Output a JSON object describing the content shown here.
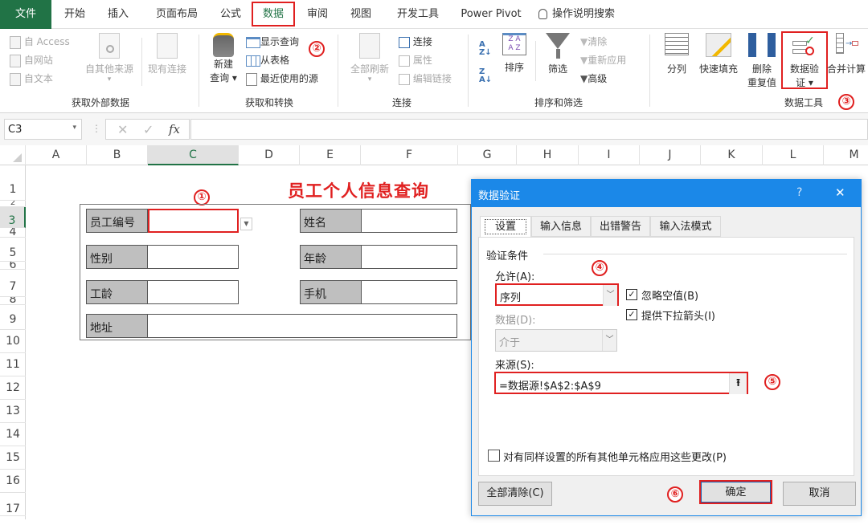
{
  "menu_tabs": [
    {
      "label": "文件"
    },
    {
      "label": "开始"
    },
    {
      "label": "插入"
    },
    {
      "label": "页面布局"
    },
    {
      "label": "公式"
    },
    {
      "label": "数据"
    },
    {
      "label": "审阅"
    },
    {
      "label": "视图"
    },
    {
      "label": "开发工具"
    },
    {
      "label": "Power Pivot"
    },
    {
      "label": "操作说明搜索"
    }
  ],
  "ribbon": {
    "get_external": {
      "label": "获取外部数据",
      "from_access": "自 Access",
      "from_web": "自网站",
      "from_text": "自文本",
      "from_other": "自其他来源",
      "existing": "现有连接"
    },
    "get_transform": {
      "label": "获取和转换",
      "new_query_1": "新建",
      "new_query_2": "查询",
      "show_queries": "显示查询",
      "from_table": "从表格",
      "recent_sources": "最近使用的源"
    },
    "connections": {
      "label": "连接",
      "refresh_all": "全部刷新",
      "connections": "连接",
      "properties": "属性",
      "edit_links": "编辑链接"
    },
    "sort_filter": {
      "label": "排序和筛选",
      "sort": "排序",
      "filter": "筛选",
      "clear": "清除",
      "reapply": "重新应用",
      "advanced": "高级"
    },
    "data_tools": {
      "label": "数据工具",
      "text_to_columns": "分列",
      "flash_fill": "快速填充",
      "remove_dup_1": "删除",
      "remove_dup_2": "重复值",
      "validation_1": "数据验",
      "validation_2": "证",
      "consolidate": "合并计算"
    }
  },
  "annotations": {
    "n1": "①",
    "n2": "②",
    "n3": "③",
    "n4": "④",
    "n5": "⑤",
    "n6": "⑥"
  },
  "formula_bar": {
    "name_box": "C3",
    "fx": "fx",
    "formula": ""
  },
  "columns": [
    "A",
    "B",
    "C",
    "D",
    "E",
    "F",
    "G",
    "H",
    "I",
    "J",
    "K",
    "L",
    "M"
  ],
  "rows": [
    "1",
    "2",
    "3",
    "4",
    "5",
    "6",
    "7",
    "8",
    "9",
    "10",
    "11",
    "12",
    "13",
    "14",
    "15",
    "16",
    "17"
  ],
  "sheet": {
    "title": "员工个人信息查询",
    "fields": {
      "emp_id": "员工编号",
      "name": "姓名",
      "gender": "性别",
      "age": "年龄",
      "seniority": "工龄",
      "phone": "手机",
      "address": "地址"
    }
  },
  "dialog": {
    "title": "数据验证",
    "help": "?",
    "close": "✕",
    "tabs": [
      "设置",
      "输入信息",
      "出错警告",
      "输入法模式"
    ],
    "section": "验证条件",
    "allow_label": "允许(A):",
    "allow_value": "序列",
    "data_label": "数据(D):",
    "data_value": "介于",
    "ignore_blank": {
      "label": "忽略空值(B)",
      "checked": true
    },
    "dropdown_arrow": {
      "label": "提供下拉箭头(I)",
      "checked": true
    },
    "source_label": "来源(S):",
    "source_value": "=数据源!$A$2:$A$9",
    "apply_all": {
      "label": "对有同样设置的所有其他单元格应用这些更改(P)",
      "checked": false
    },
    "clear_all": "全部清除(C)",
    "ok": "确定",
    "cancel": "取消"
  },
  "colors": {
    "excel_green": "#217346",
    "accent_red": "#e02020",
    "dialog_blue": "#1b88e8"
  }
}
